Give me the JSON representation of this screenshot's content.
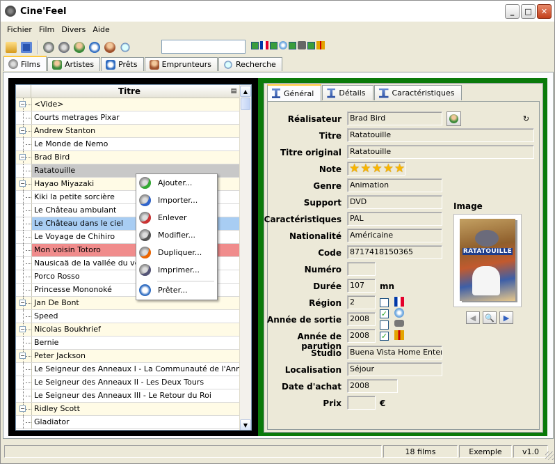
{
  "window": {
    "title": "Cine'Feel",
    "min": "_",
    "max": "□",
    "close": "✕"
  },
  "menu": [
    "Fichier",
    "Film",
    "Divers",
    "Aide"
  ],
  "search": {
    "value": ""
  },
  "tabs": [
    {
      "label": "Films",
      "icon": "film-reel-icon",
      "active": true
    },
    {
      "label": "Artistes",
      "icon": "person-icon"
    },
    {
      "label": "Prêts",
      "icon": "loan-arrow-icon"
    },
    {
      "label": "Emprunteurs",
      "icon": "borrower-icon"
    },
    {
      "label": "Recherche",
      "icon": "magnifier-icon"
    }
  ],
  "tree": {
    "column_title": "Titre",
    "rows": [
      {
        "label": "<Vide>",
        "group": true
      },
      {
        "label": "Courts metrages Pixar"
      },
      {
        "label": "Andrew Stanton",
        "group": true
      },
      {
        "label": "Le Monde de Nemo"
      },
      {
        "label": "Brad Bird",
        "group": true
      },
      {
        "label": "Ratatouille",
        "sel": "grey"
      },
      {
        "label": "Hayao Miyazaki",
        "group": true
      },
      {
        "label": "Kiki la petite sorcière"
      },
      {
        "label": "Le Château ambulant"
      },
      {
        "label": "Le Château dans le ciel",
        "sel": "blue"
      },
      {
        "label": "Le Voyage de Chihiro"
      },
      {
        "label": "Mon voisin Totoro",
        "sel": "red"
      },
      {
        "label": "Nausicaä de la vallée du vent"
      },
      {
        "label": "Porco Rosso"
      },
      {
        "label": "Princesse Mononoké"
      },
      {
        "label": "Jan De Bont",
        "group": true
      },
      {
        "label": "Speed"
      },
      {
        "label": "Nicolas Boukhrief",
        "group": true
      },
      {
        "label": "Bernie"
      },
      {
        "label": "Peter Jackson",
        "group": true
      },
      {
        "label": "Le Seigneur des Anneaux I - La Communauté de l'Anneau"
      },
      {
        "label": "Le Seigneur des Anneaux II - Les Deux Tours"
      },
      {
        "label": "Le Seigneur des Anneaux III - Le Retour du Roi"
      },
      {
        "label": "Ridley Scott",
        "group": true
      },
      {
        "label": "Gladiator"
      }
    ]
  },
  "context_menu": [
    "Ajouter...",
    "Importer...",
    "Enlever",
    "Modifier...",
    "Dupliquer...",
    "Imprimer...",
    "Prêter..."
  ],
  "detail_tabs": [
    "Général",
    "Détails",
    "Caractéristiques"
  ],
  "fields": {
    "realisateur": {
      "label": "Réalisateur",
      "value": "Brad Bird"
    },
    "titre": {
      "label": "Titre",
      "value": "Ratatouille"
    },
    "titre_original": {
      "label": "Titre original",
      "value": "Ratatouille"
    },
    "note": {
      "label": "Note",
      "stars": 5
    },
    "genre": {
      "label": "Genre",
      "value": "Animation"
    },
    "support": {
      "label": "Support",
      "value": "DVD"
    },
    "caracteristiques": {
      "label": "Caractéristiques",
      "value": "PAL"
    },
    "nationalite": {
      "label": "Nationalité",
      "value": "Américaine"
    },
    "code": {
      "label": "Code",
      "value": "8717418150365"
    },
    "numero": {
      "label": "Numéro",
      "value": ""
    },
    "duree": {
      "label": "Durée",
      "value": "107",
      "unit": "mn"
    },
    "region": {
      "label": "Région",
      "value": "2"
    },
    "annee_sortie": {
      "label": "Année de sortie",
      "value": "2008"
    },
    "annee_parution": {
      "label": "Année de parution",
      "value": "2008"
    },
    "studio": {
      "label": "Studio",
      "value": "Buena Vista Home Entertai"
    },
    "localisation": {
      "label": "Localisation",
      "value": "Séjour"
    },
    "date_achat": {
      "label": "Date d'achat",
      "value": "2008"
    },
    "prix": {
      "label": "Prix",
      "value": "",
      "unit": "€"
    }
  },
  "image": {
    "label": "Image",
    "poster_title": "RATATOUILLE"
  },
  "status": {
    "count": "18 films",
    "profile": "Exemple",
    "version": "v1.0"
  }
}
